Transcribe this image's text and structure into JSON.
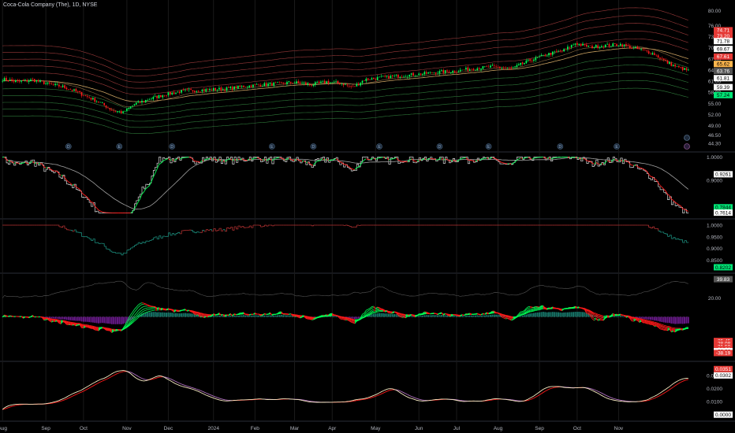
{
  "header": {
    "title": "Coca-Cola Company (The), 1D, NYSE"
  },
  "colors": {
    "background": "#000000",
    "up": "#26a69a",
    "down": "#ef5350",
    "bright_green": "#00ff55",
    "bright_red": "#ff1a1a",
    "grid": "#1a1a1a",
    "axis_text": "#b2b5be",
    "envelope_red": "#9b3a3a",
    "envelope_green": "#2f7a3a",
    "grey_line": "#a0a0a0",
    "hist_purple": "#7b1fa2",
    "hist_teal": "#1b8a7a",
    "white_line": "#ffffff",
    "orange_line": "#ff9800"
  },
  "chart_data": [
    {
      "type": "candlestick",
      "panel": "price",
      "title": "Coca-Cola Company (The), 1D, NYSE",
      "ylim": [
        43,
        82
      ],
      "yticks": [
        "80.00",
        "76.00",
        "73.00",
        "70.00",
        "67.00",
        "64.00",
        "61.00",
        "58.00",
        "55.00",
        "52.00",
        "49.00",
        "46.50",
        "44.30"
      ],
      "close_anchors": [
        {
          "t": 0,
          "v": 61.5
        },
        {
          "t": 8,
          "v": 60.9
        },
        {
          "t": 16,
          "v": 61.3
        },
        {
          "t": 24,
          "v": 60.3
        },
        {
          "t": 32,
          "v": 59.5
        },
        {
          "t": 38,
          "v": 58.4
        },
        {
          "t": 44,
          "v": 57.0
        },
        {
          "t": 52,
          "v": 55.2
        },
        {
          "t": 58,
          "v": 53.2
        },
        {
          "t": 64,
          "v": 52.5
        },
        {
          "t": 70,
          "v": 54.8
        },
        {
          "t": 78,
          "v": 56.2
        },
        {
          "t": 86,
          "v": 57.4
        },
        {
          "t": 96,
          "v": 58.3
        },
        {
          "t": 106,
          "v": 58.6
        },
        {
          "t": 118,
          "v": 58.9
        },
        {
          "t": 130,
          "v": 59.7
        },
        {
          "t": 142,
          "v": 60.2
        },
        {
          "t": 154,
          "v": 60.7
        },
        {
          "t": 164,
          "v": 60.1
        },
        {
          "t": 172,
          "v": 60.8
        },
        {
          "t": 180,
          "v": 60.4
        },
        {
          "t": 186,
          "v": 59.3
        },
        {
          "t": 192,
          "v": 61.4
        },
        {
          "t": 200,
          "v": 61.9
        },
        {
          "t": 210,
          "v": 62.4
        },
        {
          "t": 220,
          "v": 62.8
        },
        {
          "t": 230,
          "v": 63.4
        },
        {
          "t": 240,
          "v": 63.7
        },
        {
          "t": 250,
          "v": 64.4
        },
        {
          "t": 260,
          "v": 64.9
        },
        {
          "t": 270,
          "v": 64.3
        },
        {
          "t": 280,
          "v": 66.6
        },
        {
          "t": 290,
          "v": 68.3
        },
        {
          "t": 298,
          "v": 69.3
        },
        {
          "t": 304,
          "v": 71.2
        },
        {
          "t": 312,
          "v": 70.2
        },
        {
          "t": 320,
          "v": 70.6
        },
        {
          "t": 328,
          "v": 70.9
        },
        {
          "t": 334,
          "v": 70.0
        },
        {
          "t": 340,
          "v": 69.3
        },
        {
          "t": 346,
          "v": 68.3
        },
        {
          "t": 352,
          "v": 66.2
        },
        {
          "t": 358,
          "v": 64.8
        },
        {
          "t": 364,
          "v": 63.8
        }
      ],
      "bars": 365,
      "x_tick_labels": [
        {
          "t": 0,
          "label": "Aug"
        },
        {
          "t": 23,
          "label": "Sep"
        },
        {
          "t": 43,
          "label": "Oct"
        },
        {
          "t": 66,
          "label": "Nov"
        },
        {
          "t": 88,
          "label": "Dec"
        },
        {
          "t": 112,
          "label": "2024"
        },
        {
          "t": 134,
          "label": "Feb"
        },
        {
          "t": 155,
          "label": "Mar"
        },
        {
          "t": 175,
          "label": "Apr"
        },
        {
          "t": 198,
          "label": "May"
        },
        {
          "t": 221,
          "label": "Jun"
        },
        {
          "t": 241,
          "label": "Jul"
        },
        {
          "t": 263,
          "label": "Aug"
        },
        {
          "t": 285,
          "label": "Sep"
        },
        {
          "t": 305,
          "label": "Oct"
        },
        {
          "t": 327,
          "label": "Nov"
        }
      ],
      "price_labels": [
        {
          "value": 74.71,
          "text": "74.71",
          "color": "#e53935"
        },
        {
          "value": 73.2,
          "text": "73.20",
          "color": "#e53935"
        },
        {
          "value": 71.78,
          "text": "71.78",
          "color": "#ffffff"
        },
        {
          "value": 69.67,
          "text": "69.67",
          "color": "#ffffff"
        },
        {
          "value": 67.61,
          "text": "67.61",
          "color": "#e53935"
        },
        {
          "value": 65.62,
          "text": "65.62",
          "color": "#ffb74d"
        },
        {
          "value": 63.76,
          "text": "63.76",
          "color": "#555555"
        },
        {
          "value": 61.81,
          "text": "61.81",
          "color": "#ffffff"
        },
        {
          "value": 59.39,
          "text": "59.39",
          "color": "#ffffff"
        },
        {
          "value": 57.24,
          "text": "57.24",
          "color": "#00e676"
        }
      ],
      "events": [
        {
          "t": 35,
          "label": "D"
        },
        {
          "t": 62,
          "label": "E"
        },
        {
          "t": 90,
          "label": "D"
        },
        {
          "t": 143,
          "label": "E"
        },
        {
          "t": 165,
          "label": "D"
        },
        {
          "t": 200,
          "label": "E"
        },
        {
          "t": 232,
          "label": "D"
        },
        {
          "t": 258,
          "label": "E"
        },
        {
          "t": 296,
          "label": "D"
        },
        {
          "t": 326,
          "label": "E"
        }
      ]
    },
    {
      "type": "line",
      "panel": "oscillator_1",
      "ylim": [
        0.755,
        1.005
      ],
      "yticks": [
        "1.0000",
        "0.9000"
      ],
      "labels": [
        {
          "value": 0.9261,
          "text": "0.9261",
          "color": "#ffffff"
        },
        {
          "value": 0.7844,
          "text": "0.7844",
          "color": "#00e676"
        },
        {
          "value": 0.7614,
          "text": "0.7614",
          "color": "#ffffff"
        }
      ]
    },
    {
      "type": "line",
      "panel": "oscillator_2",
      "ylim": [
        0.815,
        1.01
      ],
      "yticks": [
        "1.0000",
        "0.9500",
        "0.9000",
        "0.8500"
      ],
      "labels": [
        {
          "value": 0.8202,
          "text": "0.8202",
          "color": "#00e676"
        }
      ]
    },
    {
      "type": "line",
      "panel": "oscillator_3",
      "ylim": [
        -42,
        42
      ],
      "yticks": [
        "20.00"
      ],
      "labels": [
        {
          "value": 39.83,
          "text": "39.83",
          "color": "#555555"
        },
        {
          "value": -25.45,
          "text": "-25.45",
          "color": "#e53935"
        },
        {
          "value": -28.08,
          "text": "-28.08",
          "color": "#e53935"
        },
        {
          "value": -32.62,
          "text": "-32.62",
          "color": "#e53935"
        },
        {
          "value": -31.5,
          "text": "-31.50",
          "color": "#e53935"
        },
        {
          "value": -34.26,
          "text": "-34.26",
          "color": "#e53935"
        },
        {
          "value": -36.26,
          "text": "-36.26",
          "color": "#ffffff"
        },
        {
          "value": -38.19,
          "text": "-38.19",
          "color": "#e53935"
        }
      ]
    },
    {
      "type": "line",
      "panel": "oscillator_4",
      "ylim": [
        -0.002,
        0.038
      ],
      "yticks": [
        "0.0300",
        "0.0200",
        "0.0100"
      ],
      "labels": [
        {
          "value": 0.0351,
          "text": "0.0351",
          "color": "#e53935"
        },
        {
          "value": 0.0302,
          "text": "0.0302",
          "color": "#ffffff"
        },
        {
          "value": 0.0,
          "text": "0.0000",
          "color": "#ffffff"
        }
      ]
    }
  ]
}
